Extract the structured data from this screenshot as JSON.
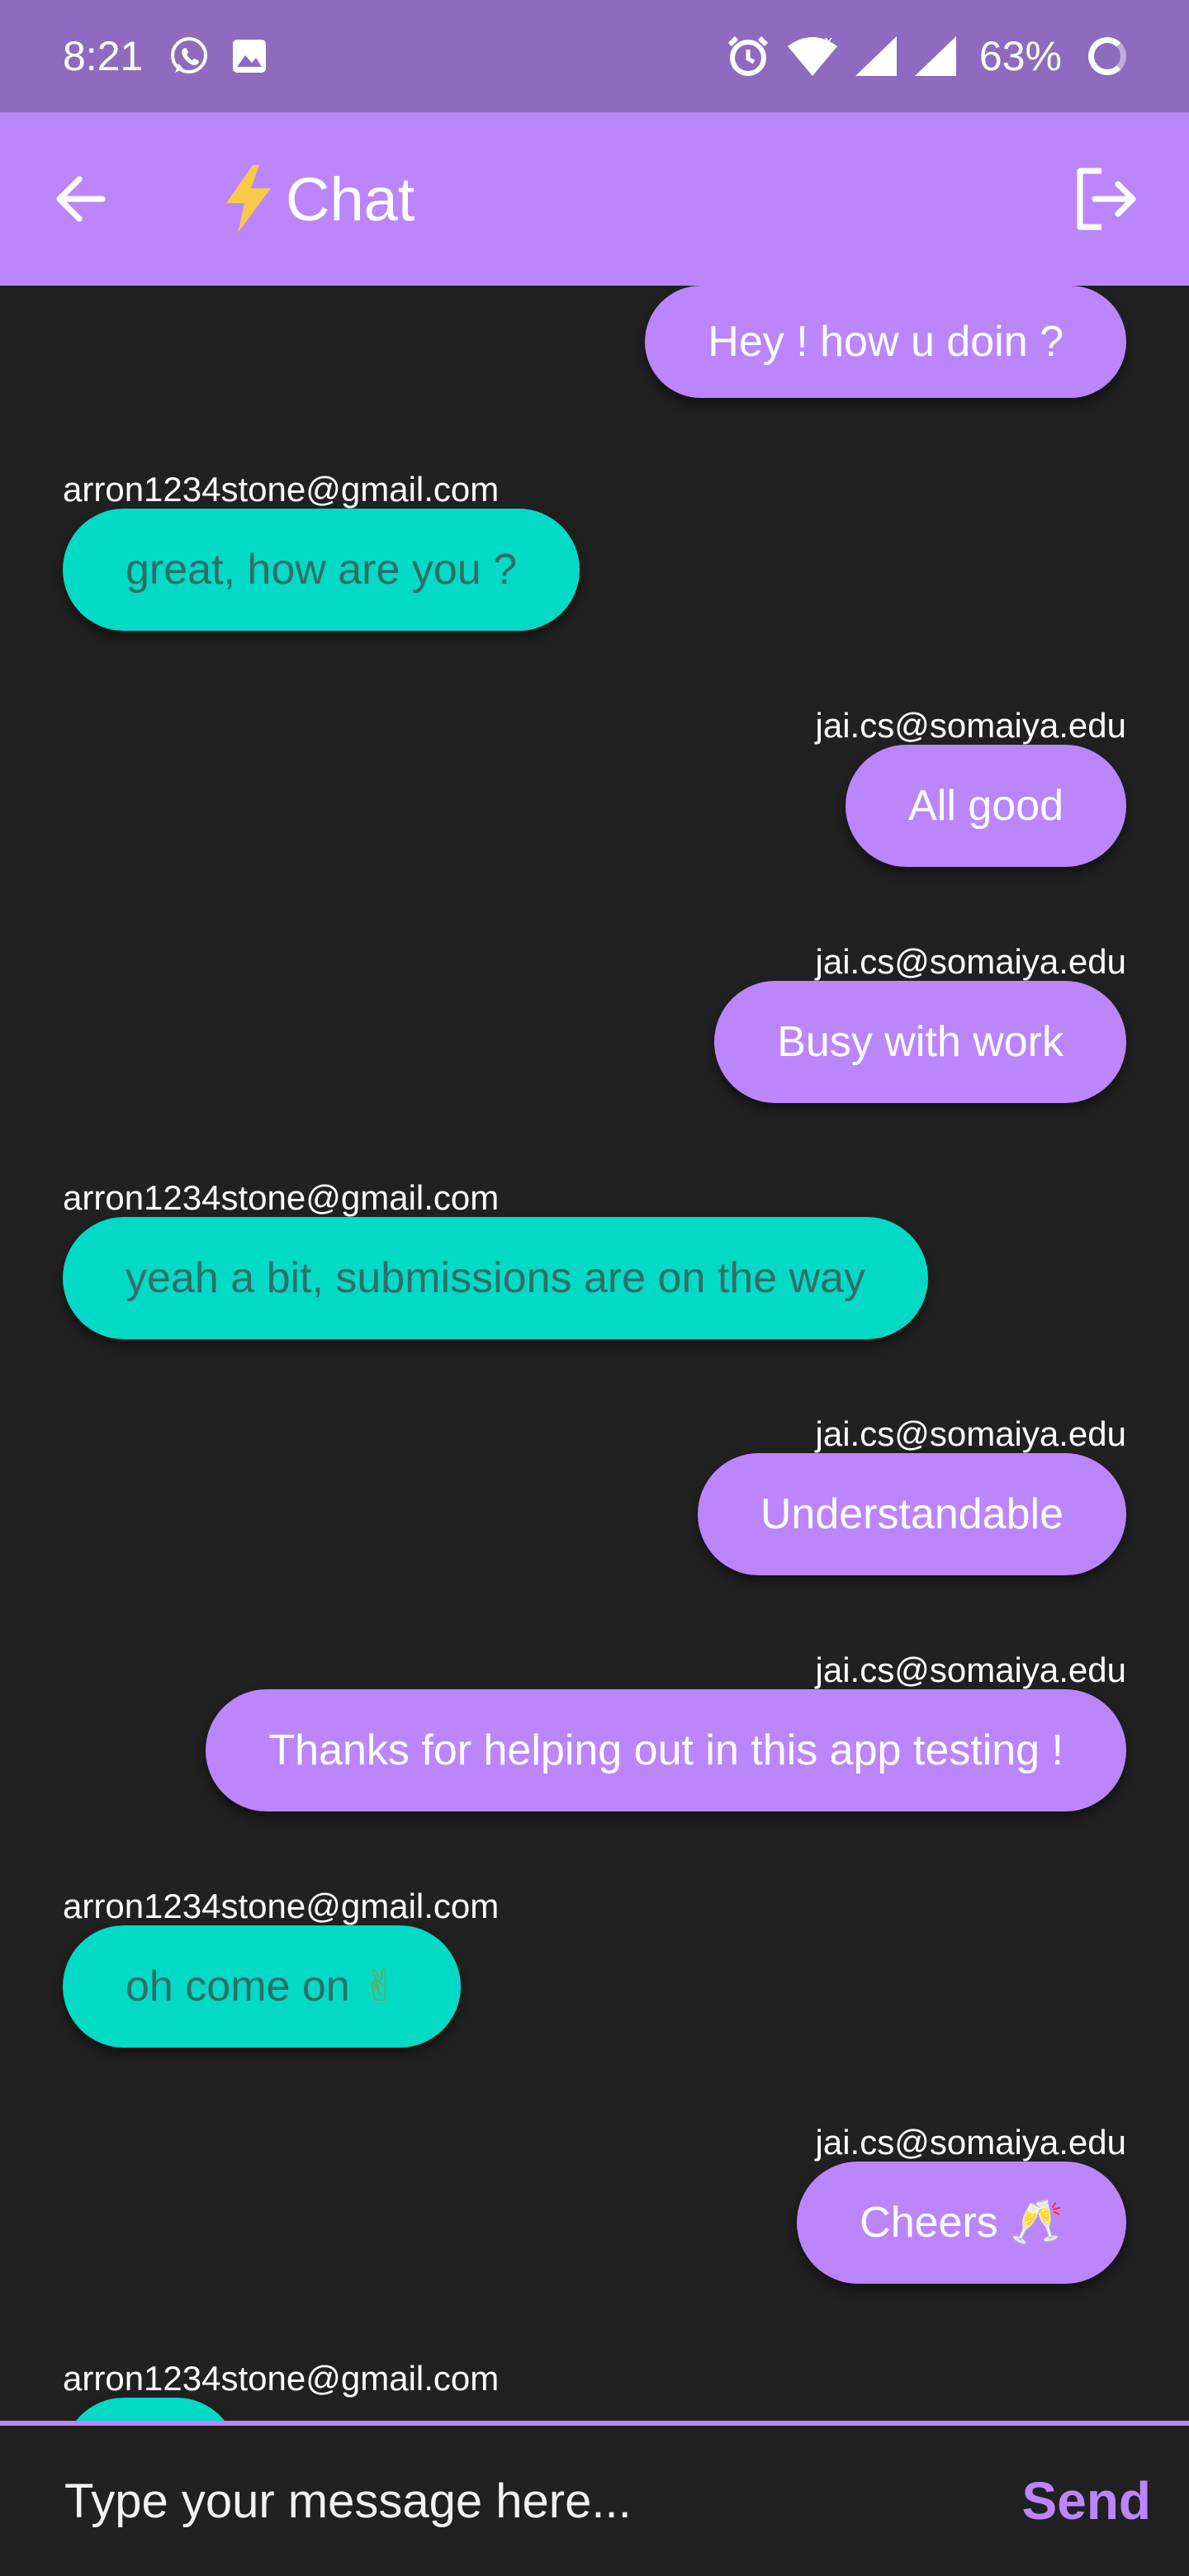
{
  "status_bar": {
    "time": "8:21",
    "battery": "63%"
  },
  "app_bar": {
    "title": "Chat",
    "accent": "#bb86fc"
  },
  "messages": [
    {
      "type": "sent",
      "sender": "",
      "text": "Hey ! how u doin ?"
    },
    {
      "type": "received",
      "sender": "arron1234stone@gmail.com",
      "text": "great, how are you ?"
    },
    {
      "type": "sent",
      "sender": "jai.cs@somaiya.edu",
      "text": "All good"
    },
    {
      "type": "sent",
      "sender": "jai.cs@somaiya.edu",
      "text": "Busy with work"
    },
    {
      "type": "received",
      "sender": "arron1234stone@gmail.com",
      "text": "yeah a bit, submissions are on the way"
    },
    {
      "type": "sent",
      "sender": "jai.cs@somaiya.edu",
      "text": "Understandable"
    },
    {
      "type": "sent",
      "sender": "jai.cs@somaiya.edu",
      "text": "Thanks for helping out in this app testing !"
    },
    {
      "type": "received",
      "sender": "arron1234stone@gmail.com",
      "text": "oh come on",
      "emoji": "✌"
    },
    {
      "type": "sent",
      "sender": "jai.cs@somaiya.edu",
      "text": "Cheers",
      "emoji": "🥂"
    },
    {
      "type": "received",
      "sender": "arron1234stone@gmail.com",
      "text": ""
    }
  ],
  "input": {
    "placeholder": "Type your message here...",
    "value": ""
  },
  "send_label": "Send",
  "colors": {
    "sent_bubble": "#bb86fc",
    "received_bubble": "#03dac5",
    "status_bar": "#8e6bbf",
    "background": "#212121"
  }
}
